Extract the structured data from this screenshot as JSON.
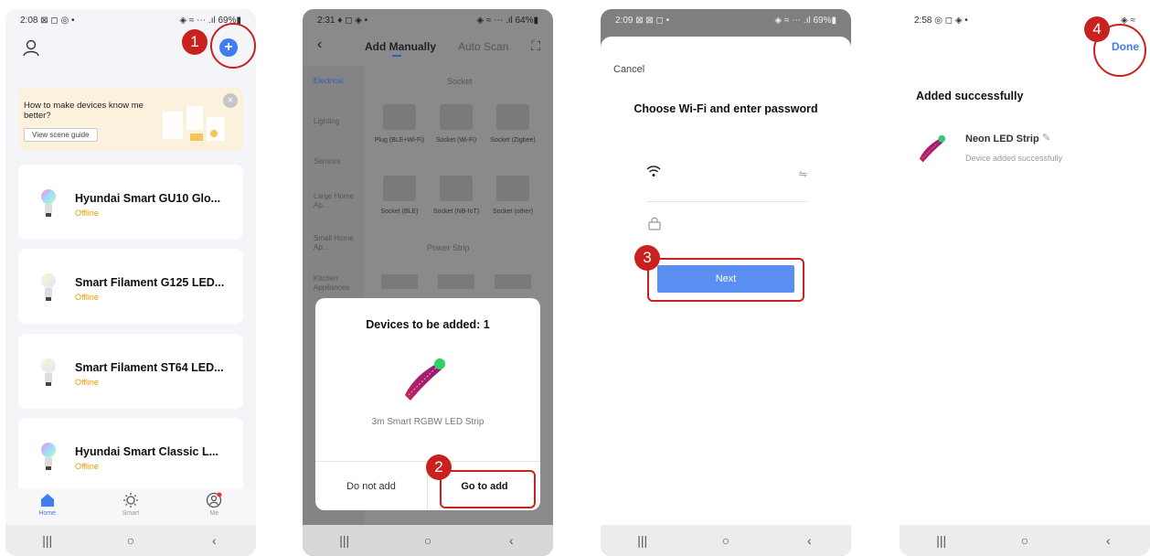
{
  "screen1": {
    "status": {
      "time": "2:08 ⊠ ◻ ◎ •",
      "right": "◈ ≈ ⋯ .ıl 69%▮"
    },
    "banner": {
      "text": "How to make devices know me better?",
      "button": "View scene guide"
    },
    "devices": [
      {
        "name": "Hyundai Smart GU10 Glo...",
        "status": "Offline"
      },
      {
        "name": "Smart Filament G125 LED...",
        "status": "Offline"
      },
      {
        "name": "Smart Filament ST64 LED...",
        "status": "Offline"
      },
      {
        "name": "Hyundai Smart Classic L...",
        "status": "Offline"
      }
    ],
    "tabs": [
      {
        "label": "Home"
      },
      {
        "label": "Smart"
      },
      {
        "label": "Me"
      }
    ]
  },
  "screen2": {
    "status": {
      "time": "2:31 ♦ ◻ ◈ •",
      "right": "◈ ≈ ⋯ .ıl 64%▮"
    },
    "header": {
      "back": "‹",
      "manual": "Add Manually",
      "auto": "Auto Scan",
      "scan": "⛶"
    },
    "categories": [
      "Electrical",
      "Lighting",
      "Sensors",
      "Large Home Ap...",
      "Small Home Ap...",
      "Kitchen Appliances"
    ],
    "sections": {
      "socket": "Socket",
      "power_strip": "Power Strip"
    },
    "sockets": [
      "Plug (BLE+Wi-Fi)",
      "Socket (Wi-Fi)",
      "Socket (Zigbee)",
      "Socket (BLE)",
      "Socket (NB-IoT)",
      "Socket (other)"
    ],
    "sheet": {
      "title": "Devices to be added: 1",
      "device": "3m Smart RGBW LED Strip",
      "not_add": "Do not add",
      "go_add": "Go to add"
    }
  },
  "screen3": {
    "status": {
      "time": "2:09 ⊠ ⊠ ◻ •",
      "right": "◈ ≈ ⋯ .ıl 69%▮"
    },
    "cancel": "Cancel",
    "title": "Choose Wi-Fi and enter password",
    "next": "Next"
  },
  "screen4": {
    "status": {
      "time": "2:58 ◎ ◻ ◈ •",
      "right": "◈ ≈"
    },
    "done": "Done",
    "added": "Added successfully",
    "device": "Neon LED Strip",
    "device_status": "Device added successfully"
  },
  "steps": [
    "1",
    "2",
    "3",
    "4"
  ],
  "nav": {
    "recent": "|||",
    "home": "○",
    "back": "‹"
  },
  "colors": {
    "accent": "#3f7df0",
    "annotation": "#c9211e",
    "offline": "#e0a000"
  }
}
